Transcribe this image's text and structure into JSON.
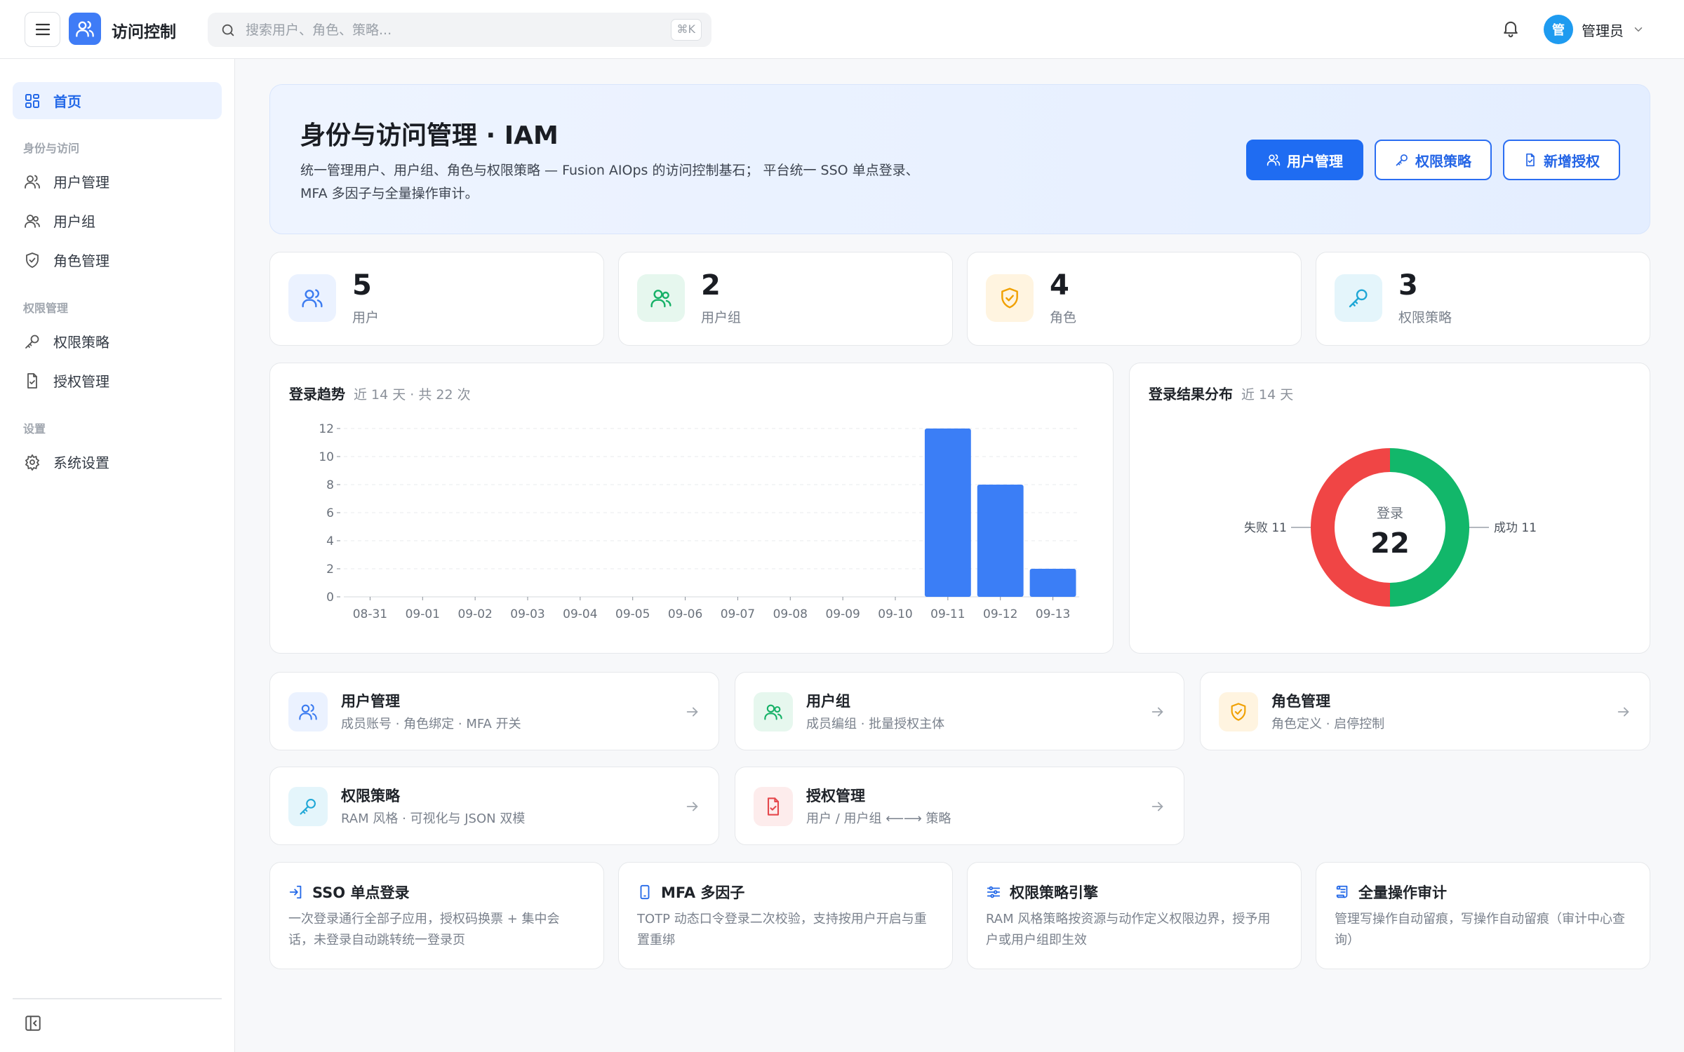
{
  "app": {
    "title": "访问控制",
    "logo_icon": "users-icon",
    "accent": "#1f6cf2"
  },
  "search": {
    "placeholder": "搜索用户、角色、策略...",
    "shortcut": "⌘K"
  },
  "header": {
    "avatar_text": "管",
    "user_name": "管理员"
  },
  "sidebar": {
    "home": "首页",
    "groups": [
      {
        "label": "身份与访问",
        "items": [
          "用户管理",
          "用户组",
          "角色管理"
        ]
      },
      {
        "label": "权限管理",
        "items": [
          "权限策略",
          "授权管理"
        ]
      },
      {
        "label": "设置",
        "items": [
          "系统设置"
        ]
      }
    ]
  },
  "hero": {
    "title": "身份与访问管理 · IAM",
    "desc": "统一管理用户、用户组、角色与权限策略 — Fusion AIOps 的访问控制基石； 平台统一 SSO 单点登录、MFA 多因子与全量操作审计。",
    "buttons": [
      "用户管理",
      "权限策略",
      "新增授权"
    ]
  },
  "stats": [
    {
      "value": "5",
      "label": "用户",
      "icon": "users-icon",
      "color": "#3b7bf0",
      "bg": "#ebf2ff"
    },
    {
      "value": "2",
      "label": "用户组",
      "icon": "user-group-icon",
      "color": "#16b167",
      "bg": "#e6f7ee"
    },
    {
      "value": "4",
      "label": "角色",
      "icon": "shield-icon",
      "color": "#f0a000",
      "bg": "#fff4e0"
    },
    {
      "value": "3",
      "label": "权限策略",
      "icon": "key-icon",
      "color": "#1fa7d6",
      "bg": "#e4f5fb"
    }
  ],
  "login_trend": {
    "title": "登录趋势",
    "subtitle": "近 14 天 · 共 22 次"
  },
  "login_result": {
    "title": "登录结果分布",
    "subtitle": "近 14 天",
    "center_label": "登录",
    "center_value": "22",
    "fail_label": "失败 11",
    "success_label": "成功 11"
  },
  "chart_data": [
    {
      "type": "bar",
      "title": "登录趋势",
      "categories": [
        "08-31",
        "09-01",
        "09-02",
        "09-03",
        "09-04",
        "09-05",
        "09-06",
        "09-07",
        "09-08",
        "09-09",
        "09-10",
        "09-11",
        "09-12",
        "09-13"
      ],
      "values": [
        0,
        0,
        0,
        0,
        0,
        0,
        0,
        0,
        0,
        0,
        0,
        12,
        8,
        2
      ],
      "ylim": [
        0,
        12
      ],
      "yticks": [
        0,
        2,
        4,
        6,
        8,
        10,
        12
      ],
      "grid": true,
      "color": "#3b7ef6"
    },
    {
      "type": "pie",
      "title": "登录结果分布",
      "donut": true,
      "slices": [
        {
          "label": "成功",
          "value": 11,
          "color": "#12b76a"
        },
        {
          "label": "失败",
          "value": 11,
          "color": "#f04545"
        }
      ]
    }
  ],
  "modules": [
    {
      "title": "用户管理",
      "desc": "成员账号 · 角色绑定 · MFA 开关",
      "icon": "users-icon",
      "color": "#3b7bf0",
      "bg": "#ebf2ff"
    },
    {
      "title": "用户组",
      "desc": "成员编组 · 批量授权主体",
      "icon": "user-group-icon",
      "color": "#16b167",
      "bg": "#e6f7ee"
    },
    {
      "title": "角色管理",
      "desc": "角色定义 · 启停控制",
      "icon": "shield-icon",
      "color": "#f0a000",
      "bg": "#fff4e0"
    },
    {
      "title": "权限策略",
      "desc": "RAM 风格 · 可视化与 JSON 双模",
      "icon": "key-icon",
      "color": "#1fa7d6",
      "bg": "#e4f5fb"
    },
    {
      "title": "授权管理",
      "desc": "用户 / 用户组 ⟵⟶ 策略",
      "icon": "file-check-icon",
      "color": "#e5484d",
      "bg": "#fdecec"
    }
  ],
  "features": [
    {
      "title": "SSO 单点登录",
      "desc": "一次登录通行全部子应用，授权码换票 + 集中会话，未登录自动跳转统一登录页",
      "icon": "login-icon"
    },
    {
      "title": "MFA 多因子",
      "desc": "TOTP 动态口令登录二次校验，支持按用户开启与重置重绑",
      "icon": "phone-icon"
    },
    {
      "title": "权限策略引擎",
      "desc": "RAM 风格策略按资源与动作定义权限边界，授予用户或用户组即生效",
      "icon": "sliders-icon"
    },
    {
      "title": "全量操作审计",
      "desc": "管理写操作自动留痕，写操作自动留痕（审计中心查询）",
      "icon": "scroll-icon"
    }
  ]
}
